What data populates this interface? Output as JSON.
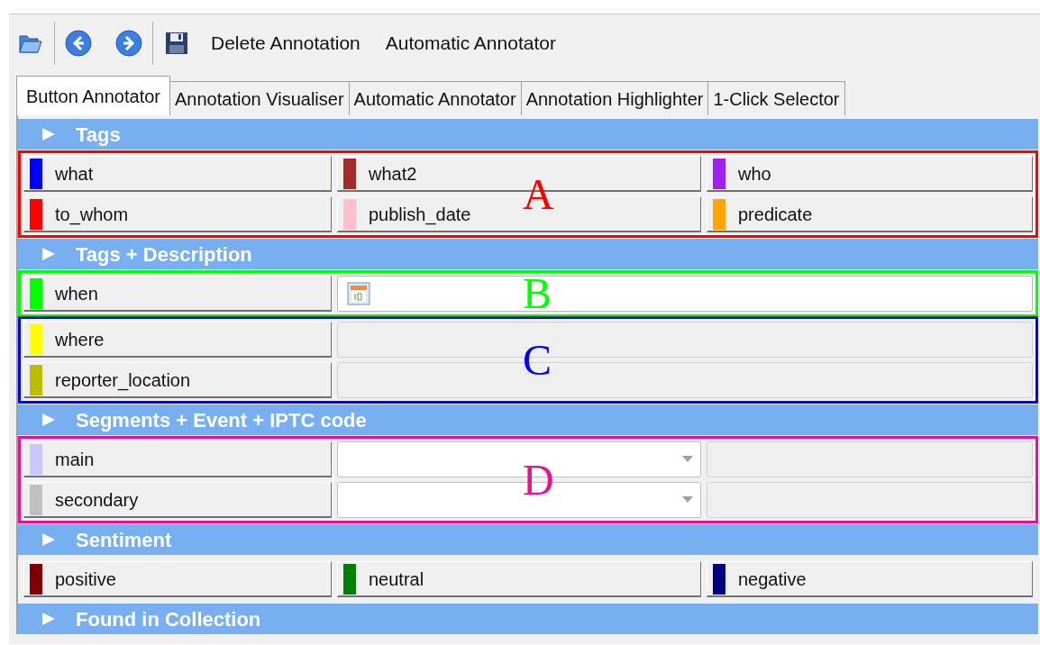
{
  "toolbar": {
    "buttons": [
      "Delete Annotation",
      "Automatic Annotator"
    ]
  },
  "tabs": [
    {
      "label": "Button Annotator",
      "selected": true
    },
    {
      "label": "Annotation Visualiser",
      "selected": false
    },
    {
      "label": "Automatic Annotator",
      "selected": false
    },
    {
      "label": "Annotation Highlighter",
      "selected": false
    },
    {
      "label": "1-Click Selector",
      "selected": false
    }
  ],
  "sections": [
    {
      "title": "Tags",
      "groups": [
        {
          "annotation": {
            "label": "A",
            "color": "#ff0000"
          },
          "rows": [
            {
              "kind": "tags",
              "tags": [
                {
                  "label": "what",
                  "color": "#0000ff"
                },
                {
                  "label": "what2",
                  "color": "#a52a2a"
                },
                {
                  "label": "who",
                  "color": "#a020f0"
                }
              ]
            },
            {
              "kind": "tags",
              "tags": [
                {
                  "label": "to_whom",
                  "color": "#ff0000"
                },
                {
                  "label": "publish_date",
                  "color": "#ffc0cb"
                },
                {
                  "label": "predicate",
                  "color": "#ffa500"
                }
              ]
            }
          ]
        }
      ]
    },
    {
      "title": "Tags + Description",
      "groups": [
        {
          "annotation": {
            "label": "B",
            "color": "#00ff00"
          },
          "rows": [
            {
              "kind": "date",
              "tag": {
                "label": "when",
                "color": "#00ff00"
              }
            }
          ]
        },
        {
          "annotation": {
            "label": "C",
            "color": "#0000ff"
          },
          "rows": [
            {
              "kind": "text",
              "tag": {
                "label": "where",
                "color": "#ffff00"
              }
            },
            {
              "kind": "text",
              "tag": {
                "label": "reporter_location",
                "color": "#bdbd00"
              }
            }
          ]
        }
      ]
    },
    {
      "title": "Segments + Event + IPTC code",
      "groups": [
        {
          "annotation": {
            "label": "D",
            "color": "#e8128c"
          },
          "rows": [
            {
              "kind": "combo",
              "tag": {
                "label": "main",
                "color": "#c8c8ff"
              }
            },
            {
              "kind": "combo",
              "tag": {
                "label": "secondary",
                "color": "#c0c0c0"
              }
            }
          ]
        }
      ]
    },
    {
      "title": "Sentiment",
      "groups": [
        {
          "rows": [
            {
              "kind": "tags",
              "tags": [
                {
                  "label": "positive",
                  "color": "#800000"
                },
                {
                  "label": "neutral",
                  "color": "#008000"
                },
                {
                  "label": "negative",
                  "color": "#000080"
                }
              ]
            }
          ]
        }
      ]
    },
    {
      "title": "Found in Collection"
    }
  ]
}
